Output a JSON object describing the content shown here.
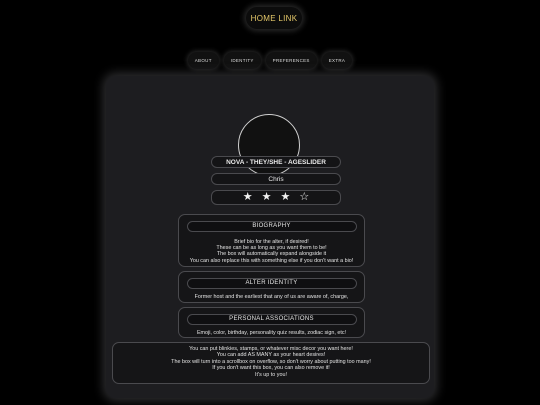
{
  "header": {
    "home_link": "HOME LINK"
  },
  "nav": {
    "tabs": [
      "ABOUT",
      "IDENTITY",
      "PREFERENCES",
      "EXTRA"
    ]
  },
  "profile": {
    "name_line": "NOVA - THEY/SHE - AGESLIDER",
    "pronoun_line": "Chris",
    "rating": {
      "filled": 3,
      "total": 4
    }
  },
  "biography": {
    "title": "BIOGRAPHY",
    "lines": [
      "Brief bio for the alter, if desired!",
      "These can be as long as you want them to be!",
      "The box will automatically expand alongside it",
      "You can also replace this with something else if you don't want a bio!"
    ]
  },
  "alter_identity": {
    "title": "ALTER IDENTITY",
    "lines": [
      "Former host and the earliest that any of us are aware of, charge,"
    ]
  },
  "associations": {
    "title": "PERSONAL ASSOCIATIONS",
    "lines": [
      "Emoji, color, birthday, personality quiz results, zodiac sign, etc!"
    ]
  },
  "extra": {
    "lines": [
      "You can put blinkies, stamps, or whatever misc decor you want here!",
      "You can add AS MANY as your heart desires!",
      "The box will turn into a scrollbox on overflow, so don't worry about putting too many!",
      "If you don't want this box, you can also remove it!",
      "It's up to you!"
    ]
  },
  "colors": {
    "accent": "#e6c96a",
    "panel_bg": "#1d1d20",
    "card_bg": "#151517",
    "border": "#4a4a4e"
  },
  "icons": {
    "star_filled": "star-filled-icon",
    "star_empty": "star-empty-icon"
  }
}
